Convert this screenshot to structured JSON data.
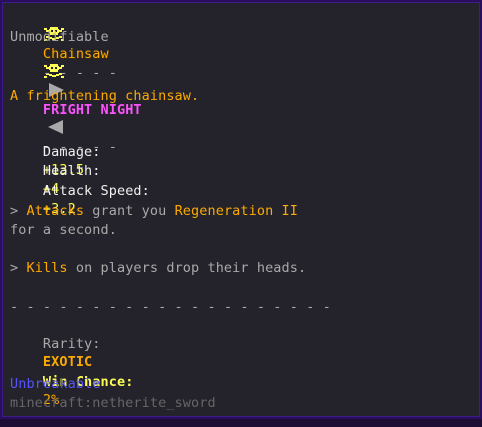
{
  "item": {
    "name": "Chainsaw",
    "modifiable": "Unmodifiable",
    "event": {
      "dashes_left": "- - - - -",
      "name": "FRIGHT NIGHT",
      "dashes_right": "- - - - -"
    },
    "description": "A frightening chainsaw.",
    "stats": [
      {
        "label": "Damage:",
        "value": "+13.5"
      },
      {
        "label": "Health:",
        "value": "+4"
      },
      {
        "label": "Attack Speed:",
        "value": "+3.2"
      }
    ],
    "ability1": {
      "prefix": "> ",
      "highlight1": "Attacks",
      "mid": " grant you ",
      "highlight2": "Regeneration II",
      "line2": "for a second."
    },
    "ability2": {
      "prefix": "> ",
      "highlight": "Kills",
      "rest": " on players drop their heads."
    },
    "separator": "- - - - - - - - - - - - - - - - - - - -",
    "rarity_label": "Rarity:",
    "rarity_value": "EXOTIC",
    "win_chance_label": "Win Chance:",
    "win_chance_value": "2%",
    "unbreakable": "Unbreakable",
    "item_id": "minecraft:netherite_sword"
  },
  "colors": {
    "background": "#24232b",
    "border": "#2a0e5e",
    "title": "#fcaa00",
    "skull": "#fcfc54",
    "event": "#fc54fc",
    "stat_value": "#fcfc54",
    "highlight": "#fcaa00",
    "unbreakable": "#5454fc"
  },
  "icons": {
    "title_decor": "skull-crossbones-icon",
    "event_left": "triangle-right-icon",
    "event_right": "triangle-left-icon"
  }
}
